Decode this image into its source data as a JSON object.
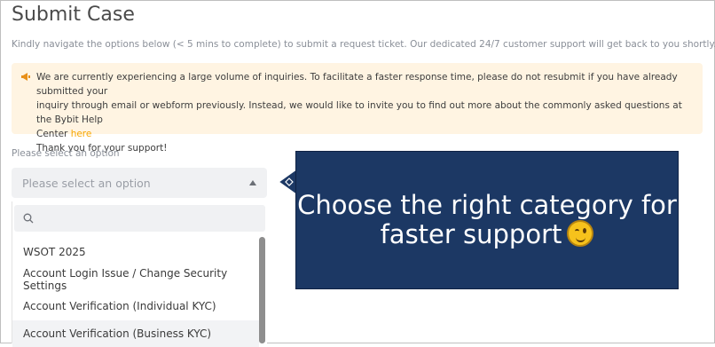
{
  "page": {
    "title": "Submit Case",
    "subtitle": "Kindly navigate the options below (< 5 mins to complete) to submit a request ticket. Our dedicated 24/7 customer support will get back to you shortly."
  },
  "notice": {
    "icon": "megaphone-icon",
    "line1": "We are currently experiencing a large volume of inquiries. To facilitate a faster response time, please do not resubmit if you have already submitted your",
    "line2": "inquiry through email or webform previously. Instead, we would like to invite you to find out more about the commonly asked questions at the Bybit Help",
    "line3_prefix": "Center ",
    "link": "here",
    "thanks": "Thank you for your support!",
    "accent_color": "#f7a600"
  },
  "select": {
    "label": "Please select an option",
    "placeholder": "Please select an option",
    "search_placeholder": "",
    "options": [
      "WSOT 2025",
      "Account Login Issue / Change Security Settings",
      "Account Verification (Individual KYC)",
      "Account Verification (Business KYC)"
    ]
  },
  "callout": {
    "line1": "Choose the right category for",
    "line2": "faster support",
    "emoji": "winking-face-emoji",
    "background": "#1c3864"
  }
}
